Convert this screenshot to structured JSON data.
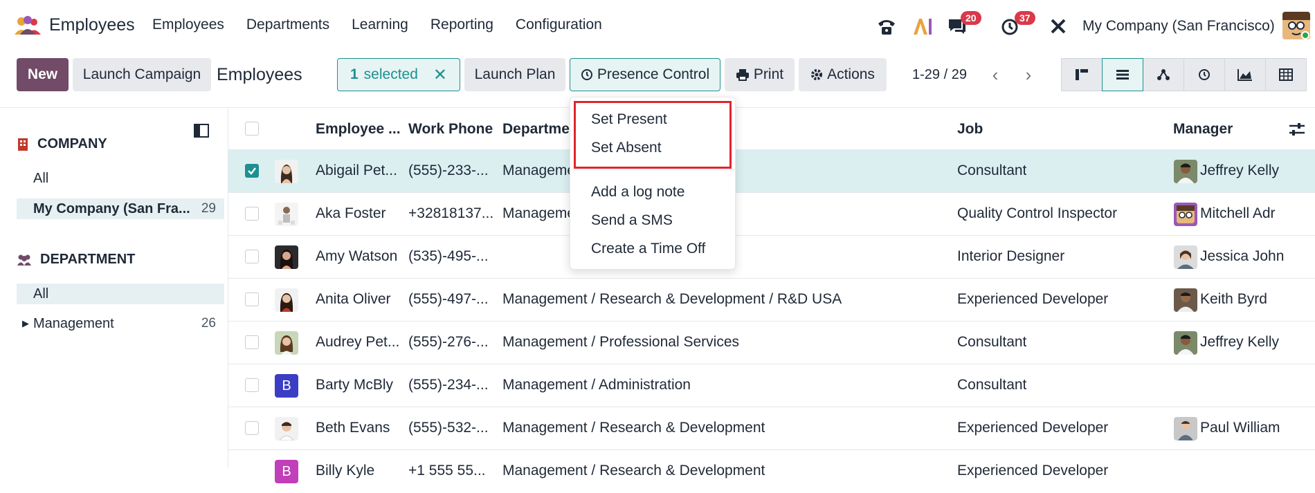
{
  "app": {
    "name": "Employees"
  },
  "nav": [
    "Employees",
    "Departments",
    "Learning",
    "Reporting",
    "Configuration"
  ],
  "systray": {
    "messages_count": "20",
    "activities_count": "37",
    "company": "My Company (San Francisco)"
  },
  "control": {
    "new_label": "New",
    "launch_campaign_label": "Launch Campaign",
    "title": "Employees",
    "selected_count": "1",
    "selected_label": "selected",
    "launch_plan_label": "Launch Plan",
    "presence_label": "Presence Control",
    "print_label": "Print",
    "actions_label": "Actions",
    "pager": "1-29 / 29"
  },
  "sidebar": {
    "company_heading": "COMPANY",
    "company_items": [
      {
        "label": "All",
        "count": ""
      },
      {
        "label": "My Company (San Fra...",
        "count": "29"
      }
    ],
    "department_heading": "DEPARTMENT",
    "department_items": [
      {
        "label": "All",
        "count": ""
      },
      {
        "label": "Management",
        "count": "26"
      }
    ]
  },
  "table": {
    "headers": [
      "Employee ...",
      "Work Phone",
      "Department",
      "Job",
      "Manager"
    ],
    "rows": [
      {
        "name": "Abigail Pet...",
        "phone": "(555)-233-...",
        "department": "Management",
        "job": "Consultant",
        "manager": "Jeffrey Kelly",
        "selected": true
      },
      {
        "name": "Aka Foster",
        "phone": "+32818137...",
        "department": "Management",
        "job": "Quality Control Inspector",
        "manager": "Mitchell Adr",
        "selected": false
      },
      {
        "name": "Amy Watson",
        "phone": "(535)-495-...",
        "department": "",
        "job": "Interior Designer",
        "manager": "Jessica John",
        "selected": false
      },
      {
        "name": "Anita Oliver",
        "phone": "(555)-497-...",
        "department": "Management / Research & Development / R&D USA",
        "job": "Experienced Developer",
        "manager": "Keith Byrd",
        "selected": false
      },
      {
        "name": "Audrey Pet...",
        "phone": "(555)-276-...",
        "department": "Management / Professional Services",
        "job": "Consultant",
        "manager": "Jeffrey Kelly",
        "selected": false
      },
      {
        "name": "Barty McBly",
        "phone": "(555)-234-...",
        "department": "Management / Administration",
        "job": "Consultant",
        "manager": "",
        "selected": false
      },
      {
        "name": "Beth Evans",
        "phone": "(555)-532-...",
        "department": "Management / Research & Development",
        "job": "Experienced Developer",
        "manager": "Paul William",
        "selected": false
      },
      {
        "name": "Billy Kyle",
        "phone": "+1 555 55...",
        "department": "Management / Research & Development",
        "job": "Experienced Developer",
        "manager": "",
        "selected": false
      }
    ],
    "barty_initial": "B",
    "billy_initial": "B"
  },
  "dropdown": {
    "items": [
      "Set Present",
      "Set Absent",
      "Add a log note",
      "Send a SMS",
      "Create a Time Off"
    ]
  },
  "colors": {
    "brand": "#714b67",
    "teal": "#1f8f8f",
    "highlight": "#e0242f",
    "badge": "#d9394a"
  }
}
